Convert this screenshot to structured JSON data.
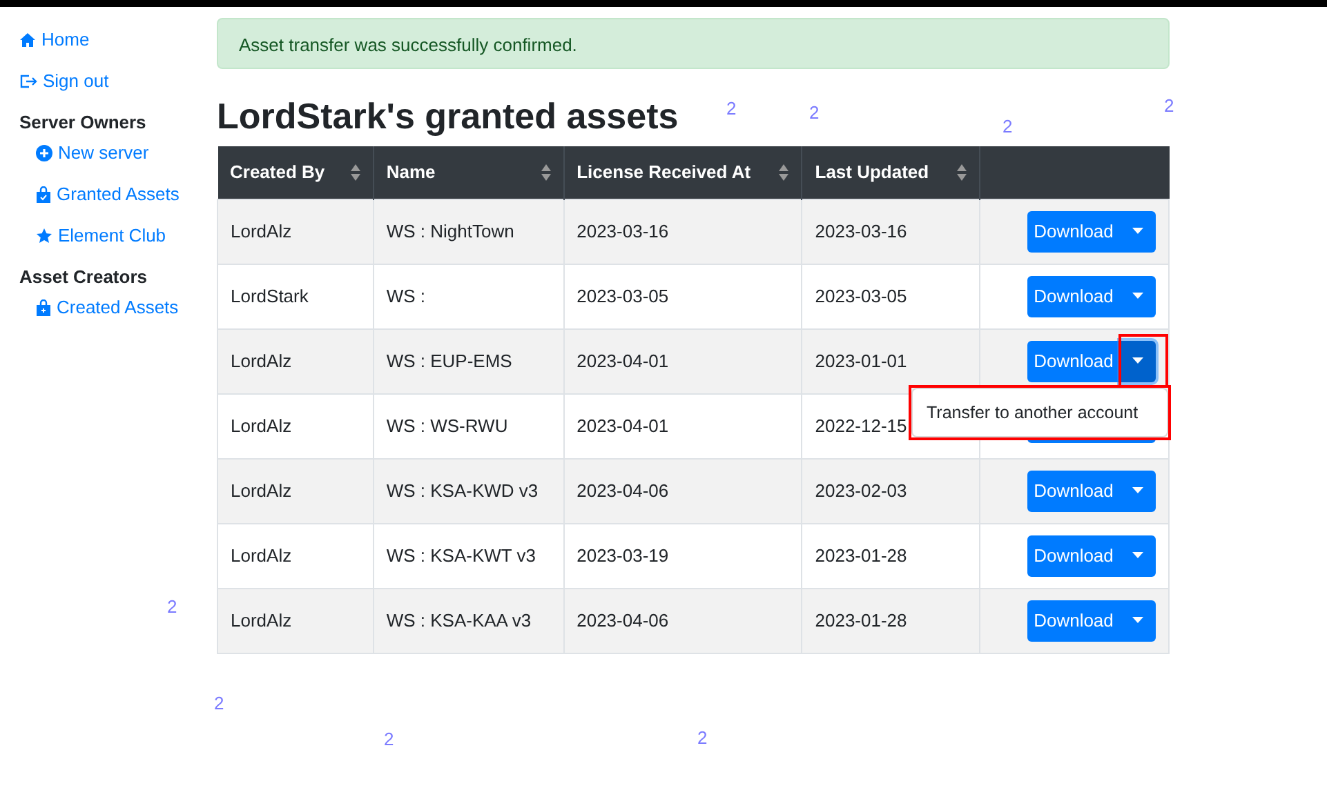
{
  "sidebar": [
    {
      "kind": "link",
      "label": "Home"
    },
    {
      "kind": "link",
      "label": "Sign out"
    },
    {
      "kind": "heading",
      "label": "Server Owners"
    },
    {
      "kind": "sublink",
      "label": "New server"
    },
    {
      "kind": "sublink",
      "label": "Granted Assets"
    },
    {
      "kind": "sublink",
      "label": "Element Club"
    },
    {
      "kind": "heading",
      "label": "Asset Creators"
    },
    {
      "kind": "sublink",
      "label": "Created Assets"
    }
  ],
  "alert": "Asset transfer was successfully confirmed.",
  "title": "LordStark's granted assets",
  "table": {
    "columns": [
      "Created By",
      "Name",
      "License Received At",
      "Last Updated"
    ],
    "rows": [
      {
        "cells": [
          "LordAlz",
          "WS : NightTown",
          "2023-03-16",
          "2023-03-16"
        ],
        "action": {
          "label": "Download"
        }
      },
      {
        "cells": [
          "LordStark",
          "WS :",
          "2023-03-05",
          "2023-03-05"
        ],
        "action": {
          "label": "Download"
        }
      },
      {
        "cells": [
          "LordAlz",
          "WS : EUP-EMS",
          "2023-04-01",
          "2023-01-01"
        ],
        "action": {
          "label": "Download",
          "open": true,
          "highlighted": true,
          "menu": {
            "items": [
              "Transfer to another account"
            ],
            "highlighted": true
          }
        }
      },
      {
        "cells": [
          "LordAlz",
          "WS : WS-RWU",
          "2023-04-01",
          "2022-12-15"
        ],
        "action": {}
      },
      {
        "cells": [
          "LordAlz",
          "WS : KSA-KWD v3",
          "2023-04-06",
          "2023-02-03"
        ],
        "action": {
          "label": "Download"
        }
      },
      {
        "cells": [
          "LordAlz",
          "WS : KSA-KWT v3",
          "2023-03-19",
          "2023-01-28"
        ],
        "action": {
          "label": "Download"
        }
      },
      {
        "cells": [
          "LordAlz",
          "WS : KSA-KAA v3",
          "2023-04-06",
          "2023-01-28"
        ],
        "action": {
          "label": "Download"
        }
      }
    ]
  },
  "stray_marks": [
    "2",
    "2",
    "2",
    "2",
    "2",
    "2",
    "2",
    "2"
  ]
}
